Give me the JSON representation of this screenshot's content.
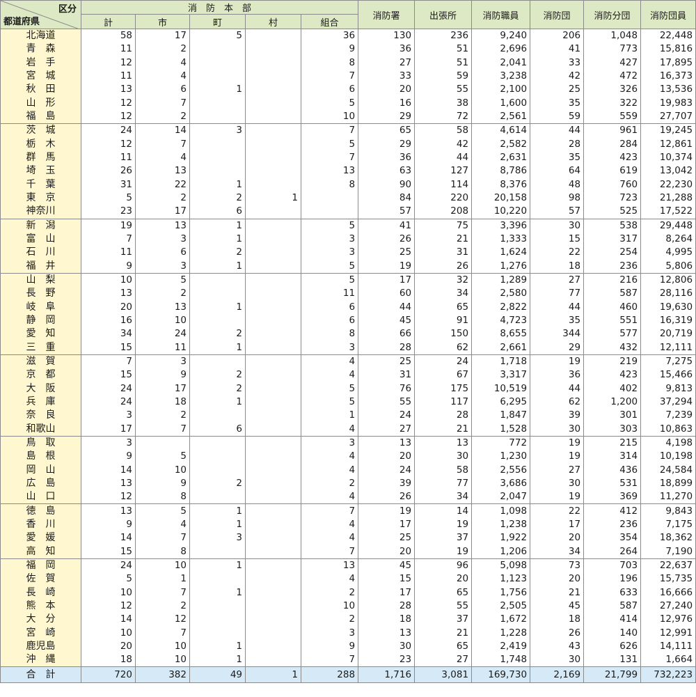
{
  "header": {
    "corner_top": "区分",
    "corner_bottom": "都道府県",
    "group_label": "消　防　本　部",
    "sub_columns": [
      "計",
      "市",
      "町",
      "村",
      "組合"
    ],
    "columns": [
      "消防署",
      "出張所",
      "消防職員",
      "消防団",
      "消防分団",
      "消防団員"
    ]
  },
  "groups": [
    {
      "rows": [
        {
          "pref": "北海道",
          "v": [
            "58",
            "17",
            "5",
            "",
            "36",
            "130",
            "236",
            "9,240",
            "206",
            "1,048",
            "22,448"
          ]
        },
        {
          "pref": "青　森",
          "v": [
            "11",
            "2",
            "",
            "",
            "9",
            "36",
            "51",
            "2,696",
            "41",
            "773",
            "15,816"
          ]
        },
        {
          "pref": "岩　手",
          "v": [
            "12",
            "4",
            "",
            "",
            "8",
            "27",
            "51",
            "2,041",
            "33",
            "427",
            "17,895"
          ]
        },
        {
          "pref": "宮　城",
          "v": [
            "11",
            "4",
            "",
            "",
            "7",
            "33",
            "59",
            "3,238",
            "42",
            "472",
            "16,373"
          ]
        },
        {
          "pref": "秋　田",
          "v": [
            "13",
            "6",
            "1",
            "",
            "6",
            "20",
            "55",
            "2,100",
            "25",
            "326",
            "13,536"
          ]
        },
        {
          "pref": "山　形",
          "v": [
            "12",
            "7",
            "",
            "",
            "5",
            "16",
            "38",
            "1,600",
            "35",
            "322",
            "19,983"
          ]
        },
        {
          "pref": "福　島",
          "v": [
            "12",
            "2",
            "",
            "",
            "10",
            "29",
            "72",
            "2,561",
            "59",
            "559",
            "27,707"
          ]
        }
      ]
    },
    {
      "rows": [
        {
          "pref": "茨　城",
          "v": [
            "24",
            "14",
            "3",
            "",
            "7",
            "65",
            "58",
            "4,614",
            "44",
            "961",
            "19,245"
          ]
        },
        {
          "pref": "栃　木",
          "v": [
            "12",
            "7",
            "",
            "",
            "5",
            "29",
            "42",
            "2,582",
            "28",
            "284",
            "12,861"
          ]
        },
        {
          "pref": "群　馬",
          "v": [
            "11",
            "4",
            "",
            "",
            "7",
            "36",
            "44",
            "2,631",
            "35",
            "423",
            "10,374"
          ]
        },
        {
          "pref": "埼　玉",
          "v": [
            "26",
            "13",
            "",
            "",
            "13",
            "63",
            "127",
            "8,786",
            "64",
            "619",
            "13,042"
          ]
        },
        {
          "pref": "千　葉",
          "v": [
            "31",
            "22",
            "1",
            "",
            "8",
            "90",
            "114",
            "8,376",
            "48",
            "760",
            "22,230"
          ]
        },
        {
          "pref": "東　京",
          "v": [
            "5",
            "2",
            "2",
            "1",
            "",
            "84",
            "220",
            "20,158",
            "98",
            "723",
            "21,288"
          ]
        },
        {
          "pref": "神奈川",
          "v": [
            "23",
            "17",
            "6",
            "",
            "",
            "57",
            "208",
            "10,220",
            "57",
            "525",
            "17,522"
          ]
        }
      ]
    },
    {
      "rows": [
        {
          "pref": "新　潟",
          "v": [
            "19",
            "13",
            "1",
            "",
            "5",
            "41",
            "75",
            "3,396",
            "30",
            "538",
            "29,448"
          ]
        },
        {
          "pref": "富　山",
          "v": [
            "7",
            "3",
            "1",
            "",
            "3",
            "26",
            "21",
            "1,333",
            "15",
            "317",
            "8,264"
          ]
        },
        {
          "pref": "石　川",
          "v": [
            "11",
            "6",
            "2",
            "",
            "3",
            "25",
            "31",
            "1,624",
            "22",
            "254",
            "4,995"
          ]
        },
        {
          "pref": "福　井",
          "v": [
            "9",
            "3",
            "1",
            "",
            "5",
            "19",
            "26",
            "1,276",
            "18",
            "236",
            "5,806"
          ]
        }
      ]
    },
    {
      "rows": [
        {
          "pref": "山　梨",
          "v": [
            "10",
            "5",
            "",
            "",
            "5",
            "17",
            "32",
            "1,289",
            "27",
            "216",
            "12,806"
          ]
        },
        {
          "pref": "長　野",
          "v": [
            "13",
            "2",
            "",
            "",
            "11",
            "60",
            "34",
            "2,580",
            "77",
            "587",
            "28,116"
          ]
        },
        {
          "pref": "岐　阜",
          "v": [
            "20",
            "13",
            "1",
            "",
            "6",
            "44",
            "65",
            "2,822",
            "44",
            "460",
            "19,630"
          ]
        },
        {
          "pref": "静　岡",
          "v": [
            "16",
            "10",
            "",
            "",
            "6",
            "45",
            "91",
            "4,723",
            "35",
            "551",
            "16,319"
          ]
        },
        {
          "pref": "愛　知",
          "v": [
            "34",
            "24",
            "2",
            "",
            "8",
            "66",
            "150",
            "8,655",
            "344",
            "577",
            "20,719"
          ]
        },
        {
          "pref": "三　重",
          "v": [
            "15",
            "11",
            "1",
            "",
            "3",
            "28",
            "62",
            "2,661",
            "29",
            "432",
            "12,111"
          ]
        }
      ]
    },
    {
      "rows": [
        {
          "pref": "滋　賀",
          "v": [
            "7",
            "3",
            "",
            "",
            "4",
            "25",
            "24",
            "1,718",
            "19",
            "219",
            "7,275"
          ]
        },
        {
          "pref": "京　都",
          "v": [
            "15",
            "9",
            "2",
            "",
            "4",
            "31",
            "67",
            "3,317",
            "36",
            "423",
            "15,466"
          ]
        },
        {
          "pref": "大　阪",
          "v": [
            "24",
            "17",
            "2",
            "",
            "5",
            "76",
            "175",
            "10,519",
            "44",
            "402",
            "9,813"
          ]
        },
        {
          "pref": "兵　庫",
          "v": [
            "24",
            "18",
            "1",
            "",
            "5",
            "55",
            "117",
            "6,295",
            "62",
            "1,200",
            "37,294"
          ]
        },
        {
          "pref": "奈　良",
          "v": [
            "3",
            "2",
            "",
            "",
            "1",
            "24",
            "28",
            "1,847",
            "39",
            "301",
            "7,239"
          ]
        },
        {
          "pref": "和歌山",
          "v": [
            "17",
            "7",
            "6",
            "",
            "4",
            "27",
            "21",
            "1,528",
            "30",
            "303",
            "10,863"
          ]
        }
      ]
    },
    {
      "rows": [
        {
          "pref": "鳥　取",
          "v": [
            "3",
            "",
            "",
            "",
            "3",
            "13",
            "13",
            "772",
            "19",
            "215",
            "4,198"
          ]
        },
        {
          "pref": "島　根",
          "v": [
            "9",
            "5",
            "",
            "",
            "4",
            "20",
            "30",
            "1,230",
            "19",
            "314",
            "10,198"
          ]
        },
        {
          "pref": "岡　山",
          "v": [
            "14",
            "10",
            "",
            "",
            "4",
            "24",
            "58",
            "2,556",
            "27",
            "436",
            "24,584"
          ]
        },
        {
          "pref": "広　島",
          "v": [
            "13",
            "9",
            "2",
            "",
            "2",
            "39",
            "77",
            "3,686",
            "30",
            "531",
            "18,899"
          ]
        },
        {
          "pref": "山　口",
          "v": [
            "12",
            "8",
            "",
            "",
            "4",
            "26",
            "34",
            "2,047",
            "19",
            "369",
            "11,270"
          ]
        }
      ]
    },
    {
      "rows": [
        {
          "pref": "徳　島",
          "v": [
            "13",
            "5",
            "1",
            "",
            "7",
            "19",
            "14",
            "1,098",
            "22",
            "412",
            "9,843"
          ]
        },
        {
          "pref": "香　川",
          "v": [
            "9",
            "4",
            "1",
            "",
            "4",
            "17",
            "19",
            "1,238",
            "17",
            "236",
            "7,175"
          ]
        },
        {
          "pref": "愛　媛",
          "v": [
            "14",
            "7",
            "3",
            "",
            "4",
            "25",
            "37",
            "1,922",
            "20",
            "354",
            "18,362"
          ]
        },
        {
          "pref": "高　知",
          "v": [
            "15",
            "8",
            "",
            "",
            "7",
            "20",
            "19",
            "1,206",
            "34",
            "264",
            "7,190"
          ]
        }
      ]
    },
    {
      "rows": [
        {
          "pref": "福　岡",
          "v": [
            "24",
            "10",
            "1",
            "",
            "13",
            "45",
            "96",
            "5,098",
            "73",
            "703",
            "22,637"
          ]
        },
        {
          "pref": "佐　賀",
          "v": [
            "5",
            "1",
            "",
            "",
            "4",
            "15",
            "20",
            "1,123",
            "20",
            "196",
            "15,735"
          ]
        },
        {
          "pref": "長　崎",
          "v": [
            "10",
            "7",
            "1",
            "",
            "2",
            "17",
            "65",
            "1,756",
            "21",
            "633",
            "16,666"
          ]
        },
        {
          "pref": "熊　本",
          "v": [
            "12",
            "2",
            "",
            "",
            "10",
            "28",
            "55",
            "2,505",
            "45",
            "587",
            "27,240"
          ]
        },
        {
          "pref": "大　分",
          "v": [
            "14",
            "12",
            "",
            "",
            "2",
            "18",
            "37",
            "1,672",
            "18",
            "414",
            "12,976"
          ]
        },
        {
          "pref": "宮　崎",
          "v": [
            "10",
            "7",
            "",
            "",
            "3",
            "13",
            "21",
            "1,228",
            "26",
            "140",
            "12,991"
          ]
        },
        {
          "pref": "鹿児島",
          "v": [
            "20",
            "10",
            "1",
            "",
            "9",
            "30",
            "65",
            "2,419",
            "43",
            "626",
            "14,111"
          ]
        },
        {
          "pref": "沖　縄",
          "v": [
            "18",
            "10",
            "1",
            "",
            "7",
            "23",
            "27",
            "1,748",
            "30",
            "131",
            "1,664"
          ]
        }
      ]
    }
  ],
  "total": {
    "pref": "合　計",
    "v": [
      "720",
      "382",
      "49",
      "1",
      "288",
      "1,716",
      "3,081",
      "169,730",
      "2,169",
      "21,799",
      "732,223"
    ]
  }
}
